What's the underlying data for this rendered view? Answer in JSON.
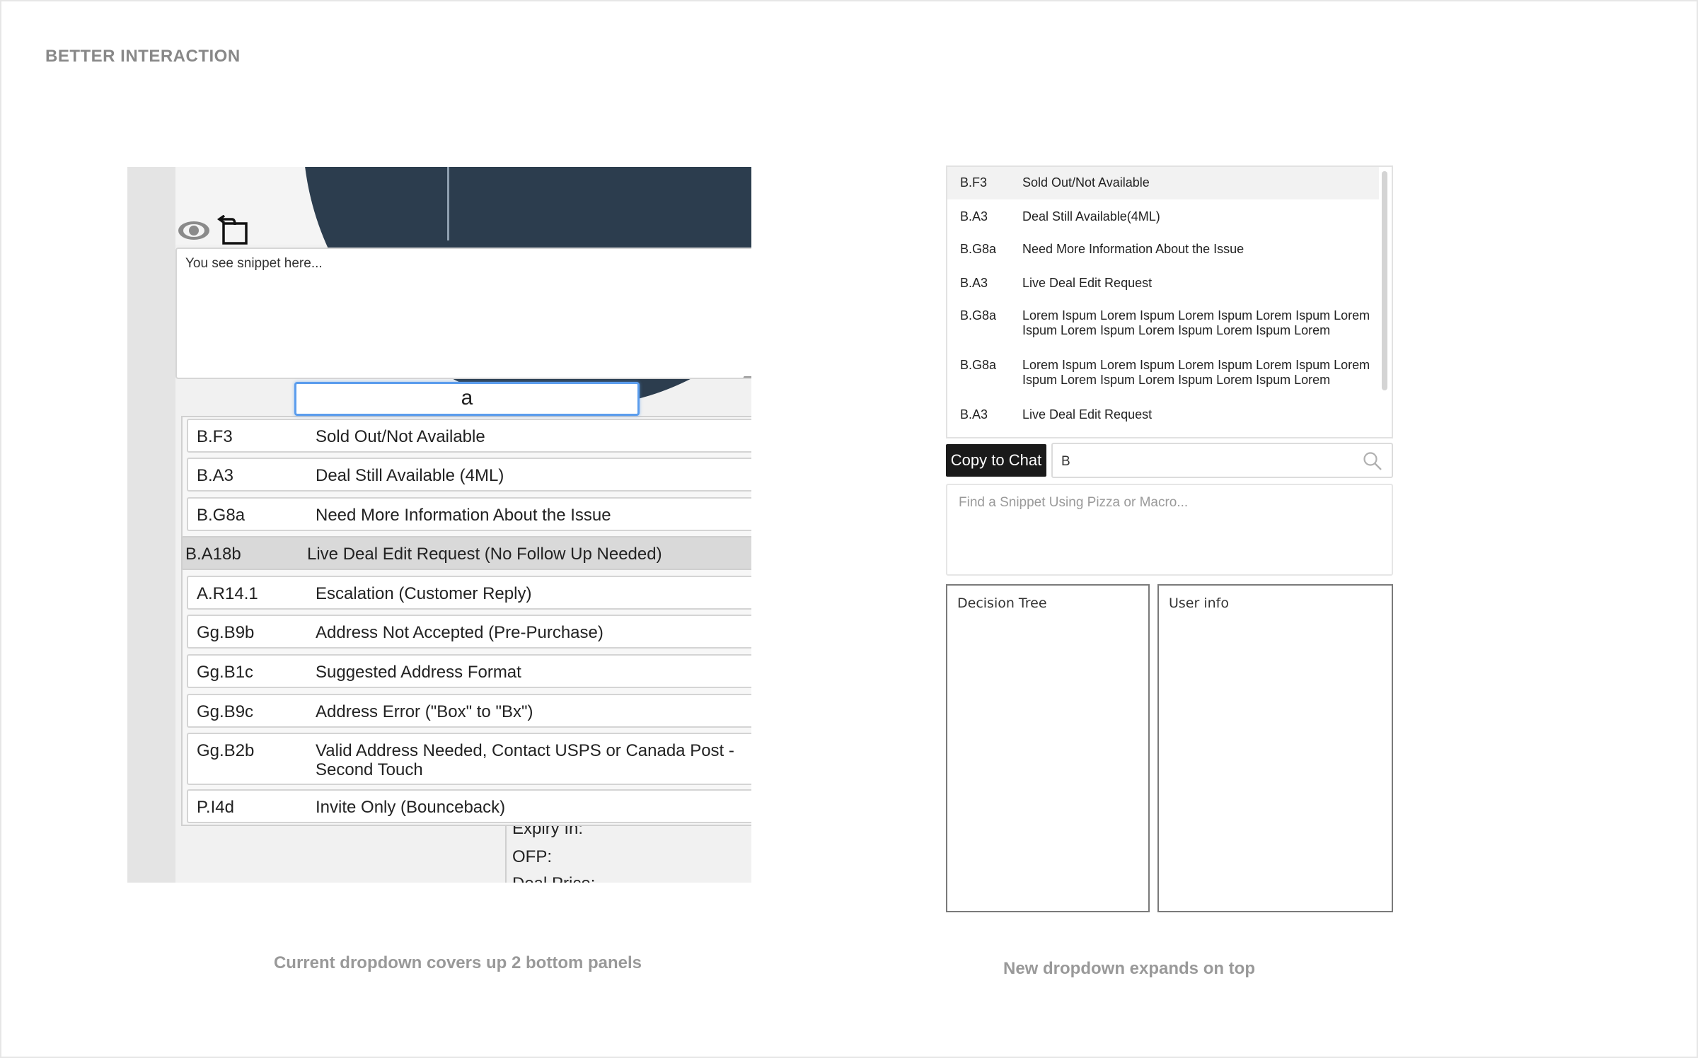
{
  "section_title": "BETTER INTERACTION",
  "left": {
    "snippet_text": "You see snippet here...",
    "search_value": "a",
    "rows": [
      {
        "code": "B.F3",
        "label": "Sold Out/Not Available"
      },
      {
        "code": "B.A3",
        "label": "Deal Still Available (4ML)"
      },
      {
        "code": "B.G8a",
        "label": "Need More Information About the Issue"
      },
      {
        "code": "B.A18b",
        "label": "Live Deal Edit Request (No Follow Up Needed)"
      },
      {
        "code": "A.R14.1",
        "label": "Escalation (Customer Reply)"
      },
      {
        "code": "Gg.B9b",
        "label": "Address Not Accepted (Pre-Purchase)"
      },
      {
        "code": "Gg.B1c",
        "label": "Suggested Address Format"
      },
      {
        "code": "Gg.B9c",
        "label": "Address Error (\"Box\" to \"Bx\")"
      },
      {
        "code": "Gg.B2b",
        "label": "Valid Address Needed, Contact USPS or Canada Post - Second Touch"
      },
      {
        "code": "P.I4d",
        "label": "Invite Only (Bounceback)"
      }
    ],
    "below_fields": [
      "Expiry In:",
      "OFP:",
      "Deal Price:"
    ],
    "caption": "Current dropdown covers up 2 bottom panels"
  },
  "right": {
    "rows": [
      {
        "code": "B.F3",
        "label": "Sold Out/Not Available"
      },
      {
        "code": "B.A3",
        "label": "Deal Still Available(4ML)"
      },
      {
        "code": "B.G8a",
        "label": "Need More Information About the Issue"
      },
      {
        "code": "B.A3",
        "label": "Live Deal Edit Request"
      },
      {
        "code": "B.G8a",
        "label": "Lorem Ispum  Lorem Ispum Lorem Ispum Lorem Ispum Lorem Ispum  Lorem Ispum  Lorem Ispum Lorem Ispum Lorem"
      },
      {
        "code": "B.G8a",
        "label": "Lorem Ispum  Lorem Ispum Lorem Ispum Lorem Ispum Lorem Ispum  Lorem Ispum  Lorem Ispum Lorem Ispum Lorem"
      },
      {
        "code": "B.A3",
        "label": "Live Deal Edit Request"
      }
    ],
    "copy_button": "Copy to Chat",
    "search_value": "B",
    "textarea_placeholder": "Find a Snippet Using Pizza or Macro...",
    "decision_tree_title": "Decision Tree",
    "user_info_title": "User info",
    "caption": "New dropdown expands on top"
  }
}
